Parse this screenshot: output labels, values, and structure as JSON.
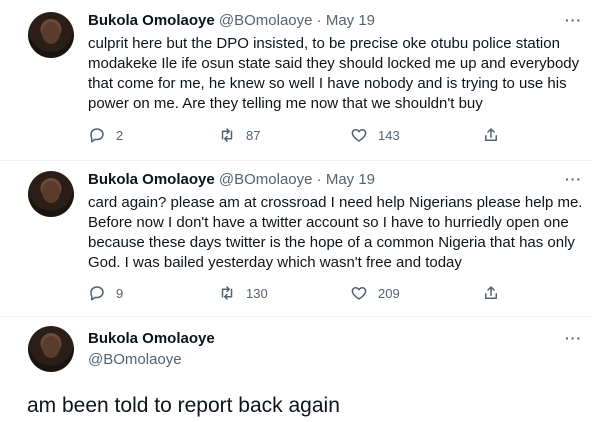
{
  "tweets": [
    {
      "name": "Bukola Omolaoye",
      "handle": "@BOmolaoye",
      "dot": "·",
      "date": "May 19",
      "lines": [
        "culprit here but the DPO insisted, to be precise oke otubu police station",
        "modakeke Ile ife osun state said they should locked me up and everybody",
        "that come for me, he knew so well I have nobody and is trying to use his",
        "power on me.  Are they telling me now that we shouldn't buy"
      ],
      "replies": "2",
      "retweets": "87",
      "likes": "143"
    },
    {
      "name": "Bukola Omolaoye",
      "handle": "@BOmolaoye",
      "dot": "·",
      "date": "May 19",
      "lines": [
        "card again? please am at crossroad I need help Nigerians please help me.",
        "Before now I don't have a twitter account so I have to hurriedly open one",
        "because these days twitter is the hope of a common Nigeria that has only",
        "God.  I was bailed yesterday which wasn't free and today"
      ],
      "replies": "9",
      "retweets": "130",
      "likes": "209"
    },
    {
      "name": "Bukola Omolaoye",
      "handle": "@BOmolaoye",
      "text": "am been told to report back again"
    }
  ],
  "icons": {
    "more": "more-horizontal-icon",
    "reply": "reply-icon",
    "retweet": "retweet-icon",
    "like": "heart-icon",
    "share": "share-icon"
  },
  "more_glyph": "···"
}
